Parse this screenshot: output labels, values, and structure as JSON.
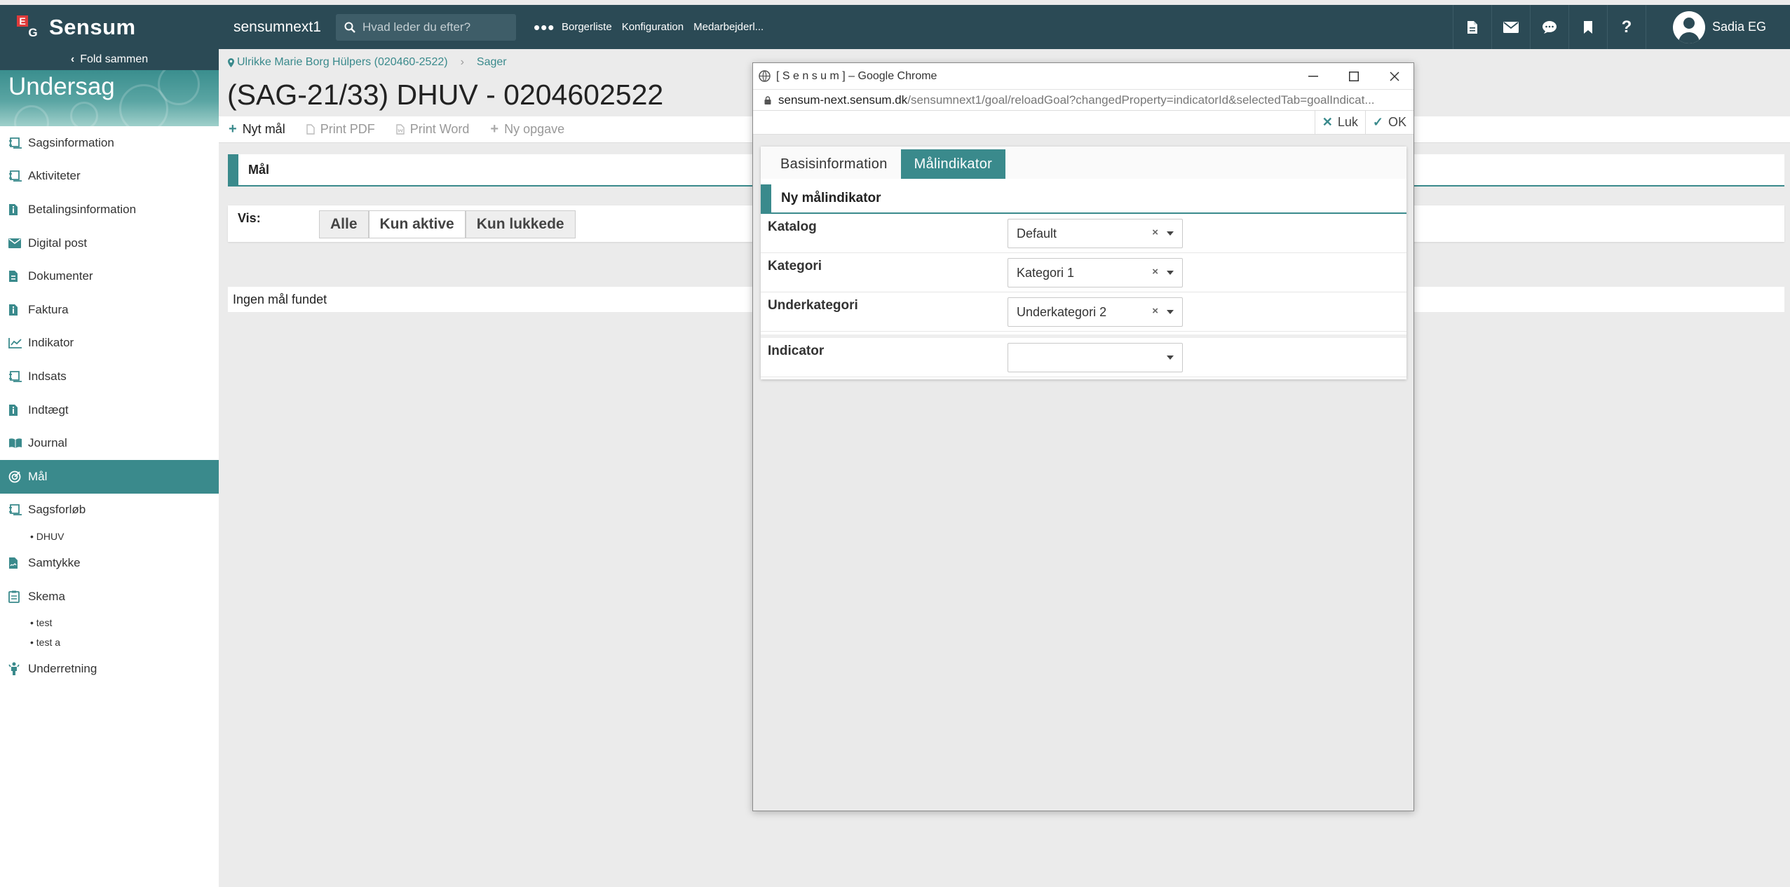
{
  "app": {
    "logo_text": "Sensum",
    "system_name": "sensumnext1",
    "search_placeholder": "Hvad leder du efter?",
    "more_label": "•••",
    "nav_links": [
      "Borgerliste",
      "Konfiguration",
      "Medarbejderl..."
    ],
    "user_name": "Sadia EG"
  },
  "sidebar": {
    "fold_label": "Fold sammen",
    "banner_title": "Undersag",
    "items": [
      {
        "label": "Sagsinformation",
        "icon": "case-icon"
      },
      {
        "label": "Aktiviteter",
        "icon": "case-icon"
      },
      {
        "label": "Betalingsinformation",
        "icon": "document-info-icon"
      },
      {
        "label": "Digital post",
        "icon": "envelope-icon"
      },
      {
        "label": "Dokumenter",
        "icon": "document-icon"
      },
      {
        "label": "Faktura",
        "icon": "document-info-icon"
      },
      {
        "label": "Indikator",
        "icon": "chart-line-icon"
      },
      {
        "label": "Indsats",
        "icon": "case-icon"
      },
      {
        "label": "Indtægt",
        "icon": "document-info-icon"
      },
      {
        "label": "Journal",
        "icon": "book-icon"
      },
      {
        "label": "Mål",
        "icon": "target-icon"
      },
      {
        "label": "Sagsforløb",
        "icon": "case-icon"
      },
      {
        "label": "Samtykke",
        "icon": "signature-icon"
      },
      {
        "label": "Skema",
        "icon": "clipboard-icon"
      },
      {
        "label": "Underretning",
        "icon": "person-alert-icon"
      }
    ],
    "sub_sagsforlob": [
      "• DHUV"
    ],
    "sub_skema": [
      "• test",
      "• test a"
    ]
  },
  "main": {
    "breadcrumb_person": "Ulrikke Marie Borg Hülpers (020460-2522)",
    "breadcrumb_section": "Sager",
    "case_title": "(SAG-21/33) DHUV - 0204602522",
    "toolbar": {
      "new_goal": "Nyt mål",
      "print_pdf": "Print PDF",
      "print_word": "Print Word",
      "new_task": "Ny opgave"
    },
    "panel_title": "Mål",
    "vis_label": "Vis:",
    "filters": [
      "Alle",
      "Kun aktive",
      "Kun lukkede"
    ],
    "empty_text": "Ingen mål fundet"
  },
  "popup": {
    "window_title": "[ S e n s u m ] – Google Chrome",
    "url_host": "sensum-next.sensum.dk",
    "url_path": "/sensumnext1/goal/reloadGoal?changedProperty=indicatorId&selectedTab=goalIndicat...",
    "close_label": "Luk",
    "ok_label": "OK",
    "tabs": [
      "Basisinformation",
      "Målindikator"
    ],
    "section_title": "Ny målindikator",
    "fields": {
      "katalog_label": "Katalog",
      "katalog_value": "Default",
      "kategori_label": "Kategori",
      "kategori_value": "Kategori 1",
      "underkategori_label": "Underkategori",
      "underkategori_value": "Underkategori 2",
      "indicator_label": "Indicator",
      "indicator_value": ""
    },
    "clear_glyph": "×"
  },
  "colors": {
    "topbar": "#2b4a55",
    "accent": "#3a8a8c",
    "logo_red": "#e03b3b"
  }
}
